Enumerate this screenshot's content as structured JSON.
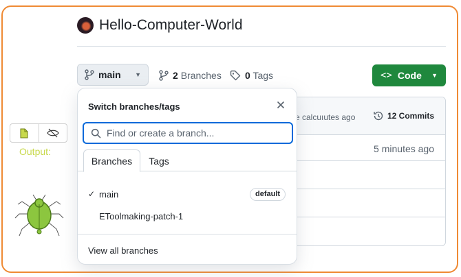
{
  "repo": {
    "name": "Hello-Computer-World"
  },
  "toolbar": {
    "branch_label": "main",
    "branches_count": "2",
    "branches_label": "Branches",
    "tags_count": "0",
    "tags_label": "Tags",
    "code_label": "Code"
  },
  "file_box": {
    "commit_msg": "e calcuıutes ago",
    "commits_label": "12 Commits",
    "updated": "5 minutes ago"
  },
  "dropdown": {
    "title": "Switch branches/tags",
    "search_placeholder": "Find or create a branch...",
    "tabs": [
      {
        "label": "Branches"
      },
      {
        "label": "Tags"
      }
    ],
    "items": [
      {
        "name": "main",
        "check": "✓",
        "badge": "default"
      },
      {
        "name": "EToolmaking-patch-1"
      }
    ],
    "footer": "View all branches"
  },
  "left_panel": {
    "output_label": "Output:"
  },
  "colors": {
    "accent": "#0969da",
    "green": "#1f883d",
    "frame": "#ef8a34",
    "output": "#c8d94c"
  }
}
